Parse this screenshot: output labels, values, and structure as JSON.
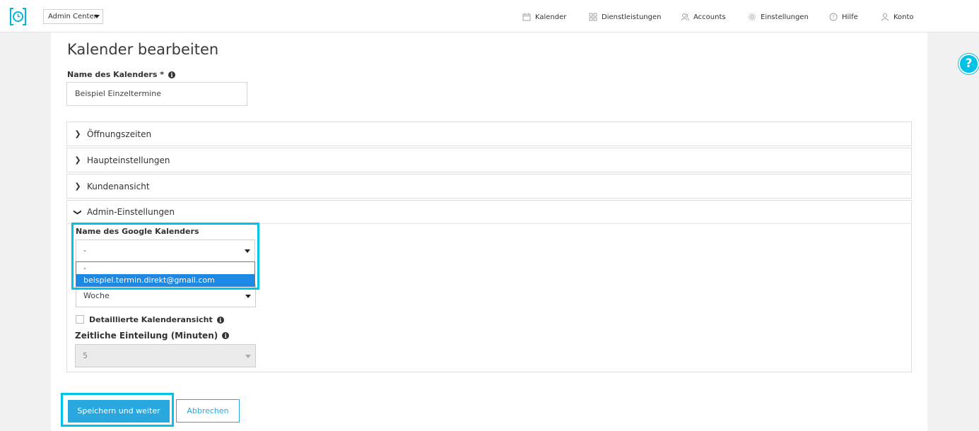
{
  "header": {
    "center_select": "Admin Center",
    "nav": [
      {
        "label": "Kalender",
        "icon": "calendar-icon"
      },
      {
        "label": "Dienstleistungen",
        "icon": "grid-icon"
      },
      {
        "label": "Accounts",
        "icon": "users-icon"
      },
      {
        "label": "Einstellungen",
        "icon": "gear-icon"
      },
      {
        "label": "Hilfe",
        "icon": "question-icon"
      },
      {
        "label": "Konto",
        "icon": "user-icon"
      }
    ]
  },
  "page": {
    "title": "Kalender bearbeiten",
    "name_label": "Name des Kalenders",
    "required_marker": "*",
    "name_value": "Beispiel Einzeltermine"
  },
  "panels": [
    {
      "label": "Öffnungszeiten",
      "expanded": false
    },
    {
      "label": "Haupteinstellungen",
      "expanded": false
    },
    {
      "label": "Kundenansicht",
      "expanded": false
    },
    {
      "label": "Admin-Einstellungen",
      "expanded": true
    }
  ],
  "admin": {
    "google_label": "Name des Google Kalenders",
    "google_value": "-",
    "google_options": [
      "-",
      "beispiel.termin.direkt@gmail.com"
    ],
    "google_selected_index": 1,
    "view_value": "Woche",
    "detail_label": "Detaillierte Kalenderansicht",
    "detail_checked": false,
    "interval_label": "Zeitliche Einteilung (Minuten)",
    "interval_value": "5"
  },
  "actions": {
    "save_label": "Speichern und weiter",
    "cancel_label": "Abbrechen"
  },
  "help_bubble": "?",
  "colors": {
    "accent": "#29a8e0",
    "highlight": "#00c3e8",
    "selected_option": "#1e88e5"
  }
}
